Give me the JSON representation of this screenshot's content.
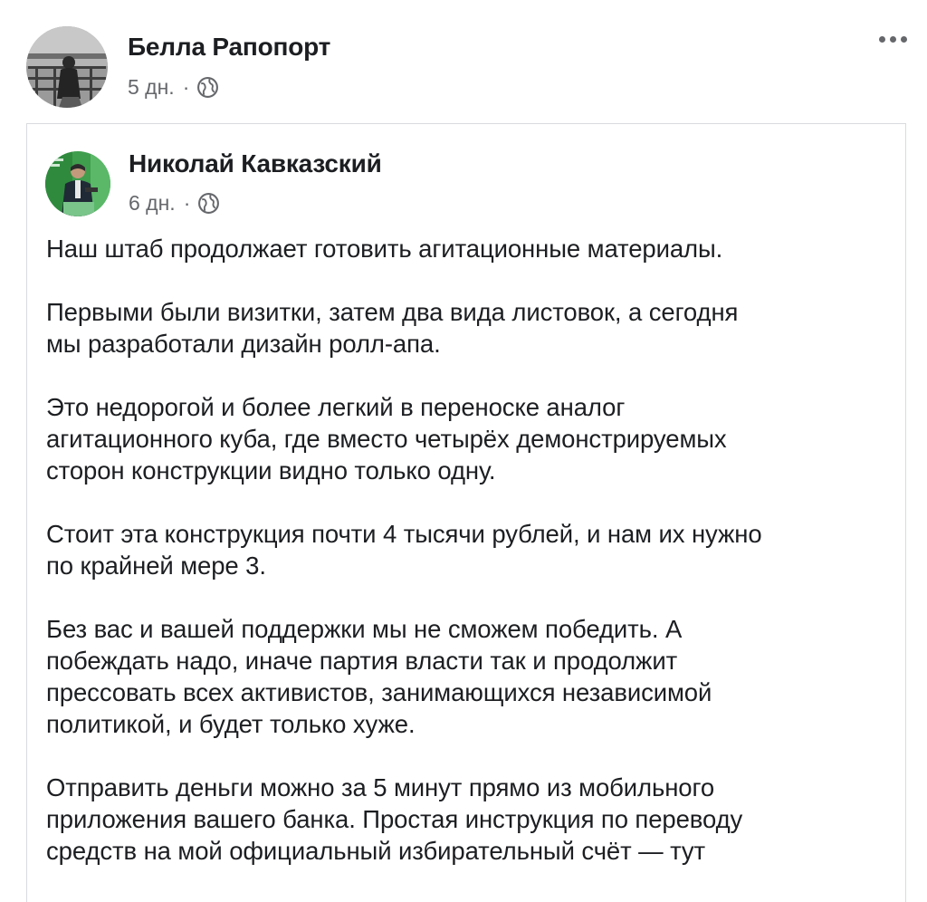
{
  "outer_post": {
    "author": "Белла Рапопорт",
    "time": "5 дн.",
    "separator": "·",
    "audience_icon": "globe-icon",
    "more_icon": "ellipsis-icon"
  },
  "shared_post": {
    "author": "Николай Кавказский",
    "time": "6 дн.",
    "separator": "·",
    "audience_icon": "globe-icon",
    "paragraphs": [
      "Наш штаб продолжает готовить агитационные материалы.",
      "Первыми были визитки, затем два вида листовок, а сегодня\nмы разработали дизайн ролл-апа.",
      "Это недорогой и более легкий в переноске аналог\nагитационного куба, где вместо четырёх демонстрируемых\nсторон конструкции видно только одну.",
      "Стоит эта конструкция почти 4 тысячи рублей, и нам их нужно\nпо крайней мере 3.",
      "Без вас и вашей поддержки мы не сможем победить. А\nпобеждать надо, иначе партия власти так и продолжит\nпрессовать всех активистов, занимающихся независимой\nполитикой, и будет только хуже.",
      "Отправить деньги можно за 5 минут прямо из мобильного\nприложения вашего банка. Простая инструкция по переводу\nсредств на мой официальный избирательный счёт — тут"
    ]
  },
  "colors": {
    "text": "#1c1e21",
    "meta": "#65676b",
    "card_border": "#d9dbdf"
  }
}
